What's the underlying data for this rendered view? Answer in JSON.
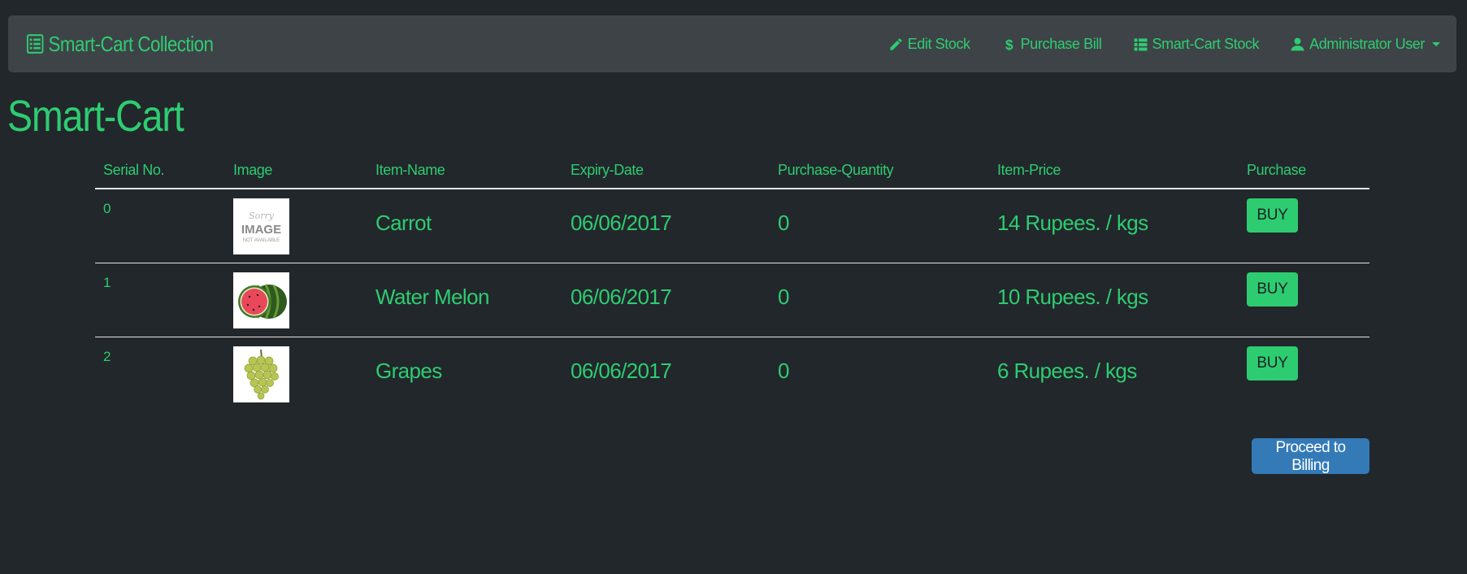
{
  "navbar": {
    "brand": "Smart-Cart Collection",
    "links": [
      {
        "label": "Edit Stock",
        "icon": "pencil-icon"
      },
      {
        "label": "Purchase Bill",
        "icon": "dollar-icon"
      },
      {
        "label": "Smart-Cart Stock",
        "icon": "list-icon"
      },
      {
        "label": "Administrator User",
        "icon": "user-icon",
        "dropdown": true
      }
    ]
  },
  "page_title": "Smart-Cart",
  "table": {
    "headers": [
      "Serial No.",
      "Image",
      "Item-Name",
      "Expiry-Date",
      "Purchase-Quantity",
      "Item-Price",
      "Purchase"
    ],
    "rows": [
      {
        "serial": "0",
        "image": "image-not-available-thumbnail",
        "name": "Carrot",
        "expiry": "06/06/2017",
        "quantity": "0",
        "price": "14 Rupees. / kgs",
        "action": "BUY"
      },
      {
        "serial": "1",
        "image": "watermelon-thumbnail",
        "name": "Water Melon",
        "expiry": "06/06/2017",
        "quantity": "0",
        "price": "10 Rupees. / kgs",
        "action": "BUY"
      },
      {
        "serial": "2",
        "image": "grapes-thumbnail",
        "name": "Grapes",
        "expiry": "06/06/2017",
        "quantity": "0",
        "price": "6 Rupees. / kgs",
        "action": "BUY"
      }
    ]
  },
  "placeholder_image_text": [
    "Sorry",
    "IMAGE",
    "NOT AVAILABLE"
  ],
  "billing_button": "Proceed to Billing",
  "colors": {
    "accent": "#2ecc71",
    "background": "#22272b",
    "navbar": "#3e4347",
    "billing": "#337ab7"
  }
}
